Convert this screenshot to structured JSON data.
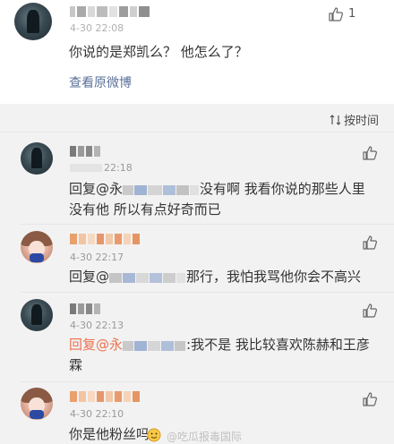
{
  "post": {
    "time": "4-30 22:08",
    "like_count": "1",
    "text": "你说的是郑凯么？  他怎么了？",
    "link_label": "查看原微博"
  },
  "sort_label": "按时间",
  "comments": [
    {
      "time": "22:18",
      "reply_prefix": "回复@永",
      "reply_text": "没有啊  我看你说的那些人里没有他  所以有点好奇而已"
    },
    {
      "time": "4-30 22:17",
      "reply_prefix": "回复@",
      "reply_text": "那行，我怕我骂他你会不高兴"
    },
    {
      "time": "4-30 22:13",
      "reply_prefix": "回复@永",
      "reply_text": ":我不是  我比较喜欢陈赫和王彦霖"
    },
    {
      "time": "4-30 22:10",
      "reply_text": "你是他粉丝吗"
    }
  ],
  "watermark": "@吃瓜报毒国际",
  "colors": {
    "mention": "#eb7350",
    "link": "#5a7299",
    "background_grey": "#f2f2f2"
  }
}
